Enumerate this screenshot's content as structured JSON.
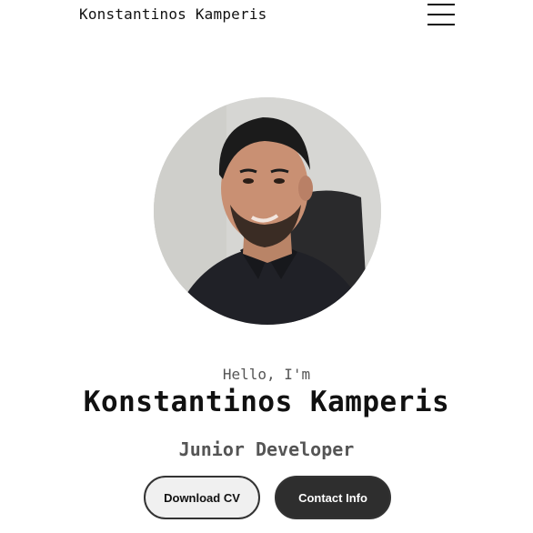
{
  "header": {
    "logo_text": "Konstantinos Kamperis",
    "menu_icon": "hamburger-menu-icon"
  },
  "hero": {
    "greeting": "Hello, I'm",
    "name": "Konstantinos Kamperis",
    "role": "Junior Developer",
    "buttons": {
      "download_cv": "Download CV",
      "contact_info": "Contact Info"
    }
  },
  "colors": {
    "background": "#ffffff",
    "text": "#111111",
    "muted_text": "#555555",
    "button_dark": "#2e2e2e",
    "button_light": "#f0f0f0"
  }
}
